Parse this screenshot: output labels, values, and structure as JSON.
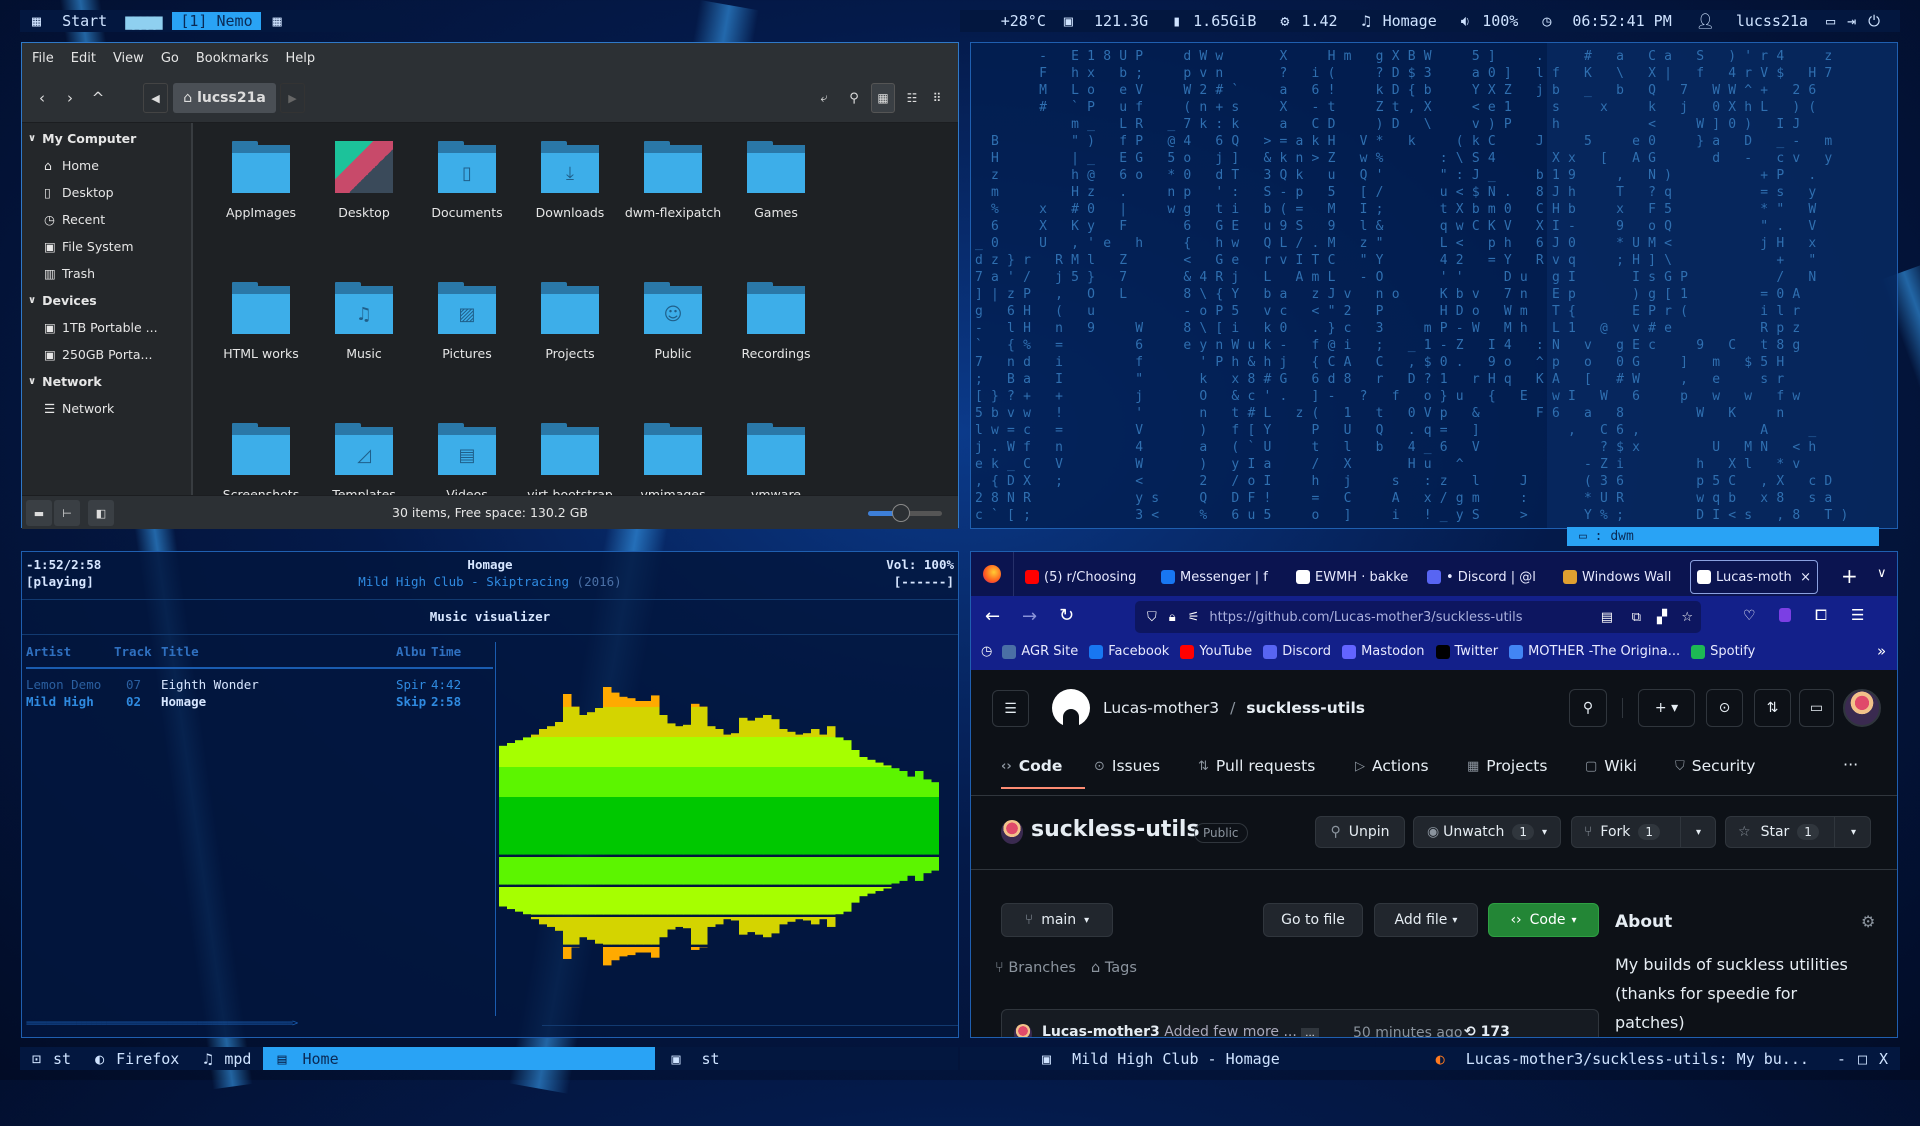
{
  "topbar": {
    "start": "Start",
    "tag": "[1] Nemo",
    "temp": "+28°C",
    "disk": "121.3G",
    "mem": "1.65GiB",
    "cpu": "1.42",
    "song": "Homage",
    "volume": "100%",
    "clock": "06:52:41 PM",
    "user": "lucss21a"
  },
  "nemo": {
    "menu": [
      "File",
      "Edit",
      "View",
      "Go",
      "Bookmarks",
      "Help"
    ],
    "location": "lucss21a",
    "sidebar": [
      {
        "type": "header",
        "label": "My Computer"
      },
      {
        "type": "item",
        "label": "Home",
        "icon": "home-icon",
        "glyph": "⌂"
      },
      {
        "type": "item",
        "label": "Desktop",
        "icon": "desktop-icon",
        "glyph": "▯"
      },
      {
        "type": "item",
        "label": "Recent",
        "icon": "clock-icon",
        "glyph": "◷"
      },
      {
        "type": "item",
        "label": "File System",
        "icon": "drive-icon",
        "glyph": "▣"
      },
      {
        "type": "item",
        "label": "Trash",
        "icon": "trash-icon",
        "glyph": "▥"
      },
      {
        "type": "header",
        "label": "Devices"
      },
      {
        "type": "item",
        "label": "1TB Portable ...",
        "icon": "drive-icon",
        "glyph": "▣"
      },
      {
        "type": "item",
        "label": "250GB Porta...",
        "icon": "drive-icon",
        "glyph": "▣"
      },
      {
        "type": "header",
        "label": "Network"
      },
      {
        "type": "item",
        "label": "Network",
        "icon": "network-icon",
        "glyph": "☰"
      }
    ],
    "files": [
      {
        "name": "AppImages",
        "emblem": ""
      },
      {
        "name": "Desktop",
        "emblem": "wallpaper"
      },
      {
        "name": "Documents",
        "emblem": "▯"
      },
      {
        "name": "Downloads",
        "emblem": "⤓"
      },
      {
        "name": "dwm-flexipatch",
        "emblem": ""
      },
      {
        "name": "Games",
        "emblem": ""
      },
      {
        "name": "HTML works",
        "emblem": ""
      },
      {
        "name": "Music",
        "emblem": "♫"
      },
      {
        "name": "Pictures",
        "emblem": "▨"
      },
      {
        "name": "Projects",
        "emblem": ""
      },
      {
        "name": "Public",
        "emblem": "☺"
      },
      {
        "name": "Recordings",
        "emblem": ""
      },
      {
        "name": "Screenshots",
        "emblem": ""
      },
      {
        "name": "Templates",
        "emblem": "◿"
      },
      {
        "name": "Videos",
        "emblem": "▤"
      },
      {
        "name": "virt-bootstrap",
        "emblem": ""
      },
      {
        "name": "vmimages",
        "emblem": ""
      },
      {
        "name": "vmware",
        "emblem": ""
      }
    ],
    "status": "30 items, Free space: 130.2 GB",
    "zoom_level": 0.45
  },
  "matrix": {
    "rows": [
      "    - E18UP  dWw   X  Hm gXBW  5]  .  # a Ca S )'r4  z",
      "    F hx b;  pvn   ? i(  ?D$3  a0] lf K \\ X| f 4rV$ H7",
      "    M Lo eV  W2#`  a 6!  kD{b  YXZ jb _ b Q 7 WW^+ 26",
      "    # `P uf  (n+s  X -t  Zt,X  <e1  s  x  k j 0XhL )(",
      "      m_ LR _7k:k  a CD  )D \\  v)P  h     <  W]0) IJ",
      " B    \") fP @4 6Q >=akH V* k  (kC  J  5  e0  }a D _- m",
      " H    |_ EG 5o j] &kn>Z w%   :\\S4   Xx [ AG   d - cv y",
      " z    h@ 6o *0 dT 3Qk u Q'   \":J_  b19  , N)     +P .",
      " m    Hz .  np ': S-p 5 [/   u<$N. 8Jh  T ?q     =s y",
      " %  x #0 |  wg ti b(= M I;   tXbm0 CHb  x F5     *\" W",
      " 6  X Ky F   6 GE u9S 9 l&   qwCKV XI-  9 oQ     \". V",
      "_0  U ,'e h  { hw QL/.M z\"   L< ph 6J0  *UM<     jH x",
      "dz}r RMl Z   < Ge rvITC \"Y   42 =Y Rvq  ;H]\\      + \"",
      "7a'/ j5} 7   &4Rj L AmL -O   ''  Du gI   IsGP     / N",
      "]|zP , O L   8\\{Y ba zJv no  Kbv 7n Ep   )g[1    =0A",
      "g 6H ( u     -oP5 vc <\"2 P   HDo Wm T{   EPr(    ilr",
      "- lH n 9  W  8\\[i k0 .}c 3  mP-W Mh L1 @ v#e     Rpz",
      "` {% =    6  eynWuk- f@i ; _1-Z I4 :N v gEc  9 C t8g",
      "7 nd i    f   'Ph&hj {CA C ,$0. 9o ^p o 0G  ] m $5H",
      "; Ba I    \"   k x8#G 6d8 r D?1 rHq KA [ #W  , e  sr",
      "[}?+ +    j   O &c'. ]- ? f o}u { E wI W 6  p w w fw",
      "5bvw !    '   n t#L z( 1 t 0Vp &   F6 a 8    W K  n",
      "lw=c =    V   ) f[Y  P U Q .q= ]     , C6,       A  _",
      "j.Wf n    4   a (`U  t l b 4_6 V       ?$x    U MN <h",
      "ek_C V    W   ) yIa  / X   Hu ^       -Zi    h Xl *v",
      ",{DX ;    <   2 /oI  h j  s :z l  J   (36    p5C ,X cD",
      "28NR      ys  Q DF!  = C  A x/gm  :   *UR    wqb x8 sa",
      "c`[;      3<  % 6u5  o ]  i !_yS  >   Y%;    DI<s ,8 T)"
    ],
    "dwm_label": "dwm"
  },
  "mpd": {
    "elapsed": "-1:52/2:58",
    "state": "[playing]",
    "title": "Homage",
    "artist_album": "Mild High Club - Skiptracing",
    "year": "(2016)",
    "volume": "Vol: 100%",
    "flags": "[------]",
    "view_title": "Music visualizer",
    "columns": {
      "artist": "Artist",
      "track": "Track",
      "title": "Title",
      "album": "Albu",
      "time": "Time"
    },
    "playlist": [
      {
        "artist": "Lemon Demo",
        "track": "07",
        "title": "Eighth Wonder",
        "album": "Spir",
        "time": "4:42",
        "current": false
      },
      {
        "artist": "Mild High",
        "track": "02",
        "title": "Homage",
        "album": "Skip",
        "time": "2:58",
        "current": true
      }
    ],
    "progress_text": "=====================================================>",
    "visualizer_levels": [
      0.58,
      0.6,
      0.62,
      0.64,
      0.66,
      0.7,
      0.72,
      0.75,
      0.95,
      0.86,
      0.8,
      0.82,
      0.85,
      1.0,
      0.96,
      0.93,
      0.92,
      0.9,
      0.9,
      0.94,
      0.8,
      0.74,
      0.72,
      0.73,
      0.88,
      0.86,
      0.72,
      0.7,
      0.66,
      0.67,
      0.78,
      0.76,
      0.78,
      0.8,
      0.77,
      0.7,
      0.68,
      0.66,
      0.67,
      0.7,
      0.66,
      0.72,
      0.64,
      0.62,
      0.55,
      0.5,
      0.48,
      0.46,
      0.44,
      0.42,
      0.4,
      0.36,
      0.4,
      0.34,
      0.32
    ],
    "colors": {
      "band1": "#00c800",
      "band2": "#5cf500",
      "band3": "#a6ff00",
      "band4": "#d4d400",
      "band5": "#ffaa00"
    }
  },
  "firefox": {
    "tabs": [
      {
        "label": "(5) r/Choosing",
        "icon": "youtube-icon",
        "color": "#ff0000"
      },
      {
        "label": "Messenger | f",
        "icon": "facebook-icon",
        "color": "#1877f2"
      },
      {
        "label": "EWMH · bakke",
        "icon": "github-icon",
        "color": "#ffffff"
      },
      {
        "label": "• Discord | @l",
        "icon": "discord-icon",
        "color": "#5865f2"
      },
      {
        "label": "Windows Wall",
        "icon": "image-icon",
        "color": "#e0a030"
      },
      {
        "label": "Lucas-moth",
        "icon": "github-icon",
        "color": "#ffffff",
        "active": true
      }
    ],
    "url_host": "https://github.com",
    "url_path": "/Lucas-mother3/suckless-utils",
    "bookmarks": [
      {
        "label": "AGR Site",
        "icon": "agr-icon",
        "color": "#4a6fa5"
      },
      {
        "label": "Facebook",
        "icon": "facebook-icon",
        "color": "#1877f2"
      },
      {
        "label": "YouTube",
        "icon": "youtube-icon",
        "color": "#ff0000"
      },
      {
        "label": "Discord",
        "icon": "discord-icon",
        "color": "#5865f2"
      },
      {
        "label": "Mastodon",
        "icon": "mastodon-icon",
        "color": "#6364ff"
      },
      {
        "label": "Twitter",
        "icon": "x-icon",
        "color": "#000000"
      },
      {
        "label": "MOTHER -The Origina...",
        "icon": "doc-icon",
        "color": "#4285f4"
      },
      {
        "label": "Spotify",
        "icon": "spotify-icon",
        "color": "#1db954"
      }
    ]
  },
  "github": {
    "owner": "Lucas-mother3",
    "sep": "/",
    "repo": "suckless-utils",
    "tabs": [
      {
        "label": "Code",
        "glyph": "‹›",
        "active": true
      },
      {
        "label": "Issues",
        "glyph": "⊙"
      },
      {
        "label": "Pull requests",
        "glyph": "⇅"
      },
      {
        "label": "Actions",
        "glyph": "▷"
      },
      {
        "label": "Projects",
        "glyph": "▦"
      },
      {
        "label": "Wiki",
        "glyph": "▢"
      },
      {
        "label": "Security",
        "glyph": "⛉"
      }
    ],
    "more": "···",
    "visibility": "Public",
    "unpin": "Unpin",
    "unwatch": "Unwatch",
    "watch_count": "1",
    "fork": "Fork",
    "fork_count": "1",
    "star": "Star",
    "star_count": "1",
    "branch": "main",
    "go_to_file": "Go to file",
    "add_file": "Add file",
    "code": "Code",
    "branches": "Branches",
    "tags": "Tags",
    "about_title": "About",
    "about_text": "My builds of suckless utilities (thanks for speedie for patches)",
    "commit_author": "Lucas-mother3",
    "commit_msg": "Added few more ...",
    "commit_ellipsis": "...",
    "commit_time": "50 minutes ago",
    "commit_count": "173",
    "accent": "#fd8c73",
    "green": "#238636"
  },
  "bottombar": {
    "items": [
      "st",
      "Firefox",
      "mpd"
    ],
    "active": "Home",
    "term": "st",
    "now_playing": "Mild High Club - Homage",
    "window_title": "Lucas-mother3/suckless-utils: My bu...",
    "minimize": "-",
    "maximize": "□",
    "close": "X"
  }
}
